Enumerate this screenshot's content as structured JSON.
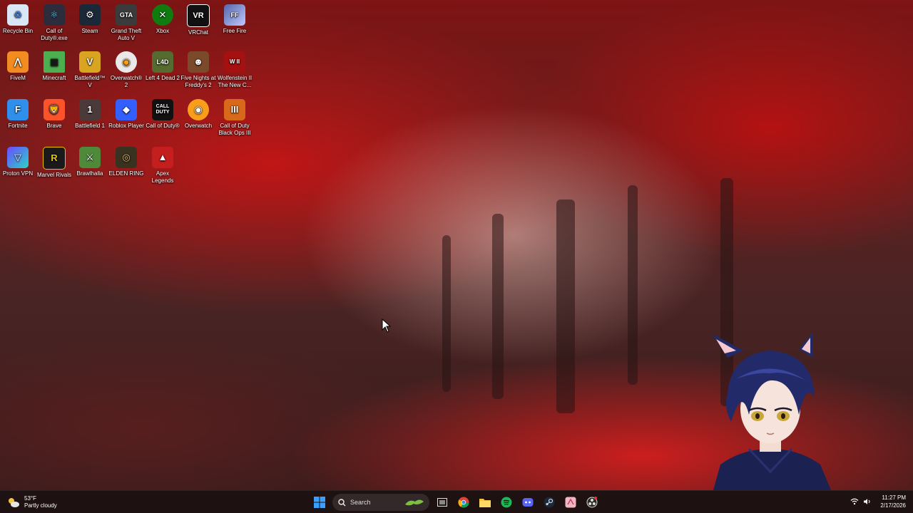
{
  "desktop": {
    "icons": [
      {
        "label": "Recycle Bin",
        "icon": "recycle-bin-icon",
        "color": "#3a7bd5"
      },
      {
        "label": "Call of Duty®.exe",
        "icon": "atom-icon",
        "color": "#2c2c3c"
      },
      {
        "label": "Steam",
        "icon": "steam-icon",
        "color": "#1b2838"
      },
      {
        "label": "Grand Theft Auto V",
        "icon": "gta-icon",
        "color": "#3b3b3b"
      },
      {
        "label": "Xbox",
        "icon": "xbox-icon",
        "color": "#107c10"
      },
      {
        "label": "VRChat",
        "icon": "vrchat-icon",
        "color": "#111111"
      },
      {
        "label": "Free Fire",
        "icon": "free-fire-icon",
        "color": "#5566aa"
      },
      {
        "label": "FiveM",
        "icon": "fivem-icon",
        "color": "#f28b20"
      },
      {
        "label": "Minecraft",
        "icon": "minecraft-icon",
        "color": "#4caf50"
      },
      {
        "label": "Battlefield™ V",
        "icon": "battlefield-v-icon",
        "color": "#d9a420"
      },
      {
        "label": "Overwatch® 2",
        "icon": "overwatch-icon",
        "color": "#e9e9e9"
      },
      {
        "label": "Left 4 Dead 2",
        "icon": "left4dead-icon",
        "color": "#556b2f"
      },
      {
        "label": "Five Nights at Freddy's 2",
        "icon": "fnaf-icon",
        "color": "#7a4a2a"
      },
      {
        "label": "Wolfenstein II The New C...",
        "icon": "wolfenstein-icon",
        "color": "#a51010"
      },
      {
        "label": "Fortnite",
        "icon": "fortnite-icon",
        "color": "#2f8fea"
      },
      {
        "label": "Brave",
        "icon": "brave-icon",
        "color": "#fb542b"
      },
      {
        "label": "Battlefield 1",
        "icon": "battlefield-1-icon",
        "color": "#4a3a3a"
      },
      {
        "label": "Roblox Player",
        "icon": "roblox-icon",
        "color": "#335fff"
      },
      {
        "label": "Call of Duty®",
        "icon": "call-of-duty-icon",
        "color": "#111111"
      },
      {
        "label": "Overwatch",
        "icon": "overwatch-legacy-icon",
        "color": "#f99e1a"
      },
      {
        "label": "Call of Duty Black Ops III",
        "icon": "black-ops-icon",
        "color": "#d9691a"
      },
      {
        "label": "Proton VPN",
        "icon": "proton-vpn-icon",
        "color": "#6d4aff"
      },
      {
        "label": "Marvel Rivals",
        "icon": "marvel-rivals-icon",
        "color": "#e6c200"
      },
      {
        "label": "Brawlhalla",
        "icon": "brawlhalla-icon",
        "color": "#4f8a3a"
      },
      {
        "label": "ELDEN RING",
        "icon": "elden-ring-icon",
        "color": "#3a3220"
      },
      {
        "label": "Apex Legends",
        "icon": "apex-legends-icon",
        "color": "#c41e1e"
      }
    ]
  },
  "taskbar": {
    "weather": {
      "temp": "53°F",
      "condition": "Partly cloudy"
    },
    "search_placeholder": "Search",
    "apps": [
      {
        "name": "start",
        "icon": "windows-start-icon",
        "color": "#3aa0ff"
      },
      {
        "name": "task-view",
        "icon": "task-view-icon",
        "color": "#dddddd"
      },
      {
        "name": "chrome",
        "icon": "chrome-icon",
        "color": "#4285f4"
      },
      {
        "name": "file-explorer",
        "icon": "folder-icon",
        "color": "#f5c542"
      },
      {
        "name": "spotify",
        "icon": "spotify-icon",
        "color": "#1db954"
      },
      {
        "name": "discord",
        "icon": "discord-icon",
        "color": "#5865f2"
      },
      {
        "name": "steam",
        "icon": "steam-icon",
        "color": "#c7d5e0"
      },
      {
        "name": "vtuber-app",
        "icon": "vtuber-app-icon",
        "color": "#f4b6c2"
      },
      {
        "name": "obs",
        "icon": "obs-icon",
        "color": "#dddddd"
      }
    ],
    "clock": {
      "time": "11:27 PM",
      "date": "2/17/2026"
    }
  },
  "colors": {
    "taskbar_bg": "#1c1214",
    "accent": "#3aa0ff"
  }
}
